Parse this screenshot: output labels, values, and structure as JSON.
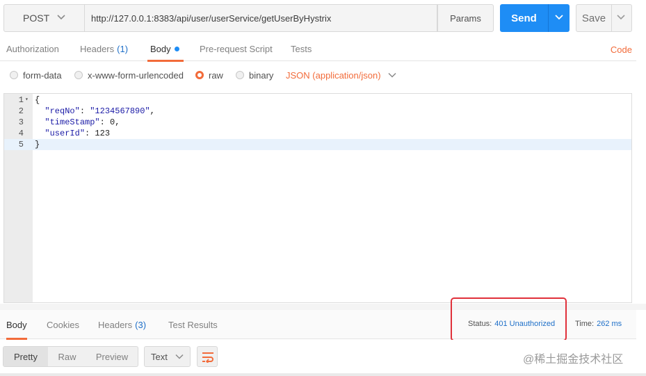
{
  "request": {
    "method": "POST",
    "url": "http://127.0.0.1:8383/api/user/userService/getUserByHystrix",
    "params_label": "Params",
    "send_label": "Send",
    "save_label": "Save"
  },
  "request_tabs": {
    "authorization": "Authorization",
    "headers_label": "Headers",
    "headers_count": "(1)",
    "body": "Body",
    "prerequest": "Pre-request Script",
    "tests": "Tests",
    "code_link": "Code"
  },
  "body_options": {
    "form_data": "form-data",
    "urlencoded": "x-www-form-urlencoded",
    "raw": "raw",
    "binary": "binary",
    "content_type": "JSON (application/json)",
    "selected": "raw"
  },
  "editor": {
    "lines": [
      {
        "num": "1",
        "text": "{"
      },
      {
        "num": "2",
        "key": "\"reqNo\"",
        "sep": ": ",
        "value": "\"1234567890\"",
        "tail": ","
      },
      {
        "num": "3",
        "key": "\"timeStamp\"",
        "sep": ": ",
        "value": "0",
        "tail": ","
      },
      {
        "num": "4",
        "key": "\"userId\"",
        "sep": ": ",
        "value": "123",
        "tail": ""
      },
      {
        "num": "5",
        "text": "}"
      }
    ]
  },
  "response_tabs": {
    "body": "Body",
    "cookies": "Cookies",
    "headers_label": "Headers",
    "headers_count": "(3)",
    "test_results": "Test Results",
    "status_label": "Status:",
    "status_value": "401 Unauthorized",
    "time_label": "Time:",
    "time_value": "262 ms"
  },
  "response_toolbar": {
    "pretty": "Pretty",
    "raw": "Raw",
    "preview": "Preview",
    "format": "Text"
  },
  "watermark": "@稀土掘金技术社区",
  "colors": {
    "accent": "#f26b3a",
    "send_blue": "#1e8df5",
    "link_blue": "#1e6fc8",
    "annotation_red": "#e0303a"
  }
}
